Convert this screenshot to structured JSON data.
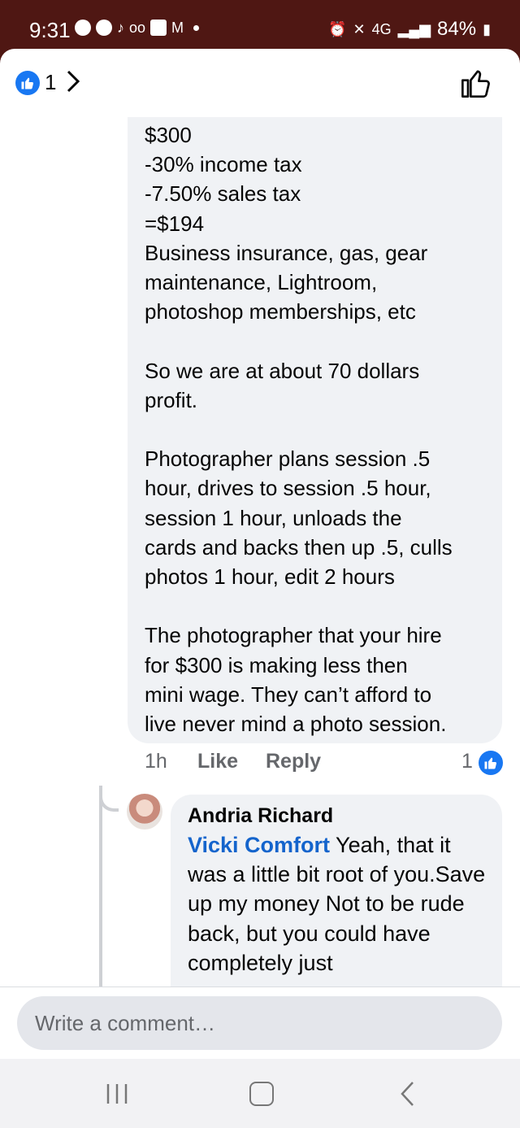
{
  "status_bar": {
    "time": "9:31",
    "network": "4G",
    "battery": "84%"
  },
  "header": {
    "like_count": "1"
  },
  "comment": {
    "text": "$300\n-30% income tax\n-7.50% sales tax\n=$194\nBusiness insurance, gas, gear\nmaintenance, Lightroom,\nphotoshop memberships, etc\n\nSo we are at about 70 dollars\nprofit.\n\nPhotographer plans session .5\nhour, drives to session .5 hour,\nsession 1 hour, unloads the\ncards and backs then up .5, culls\nphotos 1 hour, edit 2 hours\n\nThe photographer that your hire\nfor $300 is making less then\nmini wage. They can’t afford to\nlive never mind a photo session.",
    "time": "1h",
    "like_label": "Like",
    "reply_label": "Reply",
    "reaction_count": "1"
  },
  "reply": {
    "author": "Andria Richard",
    "mention": "Vicki Comfort",
    "text": " Yeah, that it was a little bit root of you.Save up my money Not to be rude back, but you could have completely just"
  },
  "composer": {
    "placeholder": "Write a comment…"
  },
  "colors": {
    "facebook_blue": "#1877f2",
    "bubble_gray": "#f0f2f5",
    "status_bar": "#4f1713"
  }
}
